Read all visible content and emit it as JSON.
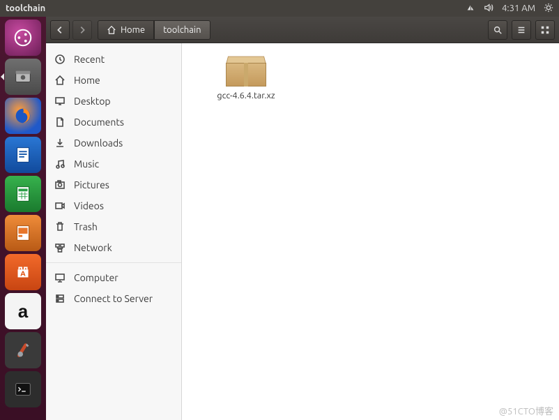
{
  "menubar": {
    "title": "toolchain",
    "time": "4:31 AM"
  },
  "launcher": {
    "items": [
      {
        "name": "dash",
        "label": "Dash"
      },
      {
        "name": "files",
        "label": "Files"
      },
      {
        "name": "firefox",
        "label": "Firefox"
      },
      {
        "name": "writer",
        "label": "LibreOffice Writer"
      },
      {
        "name": "calc",
        "label": "LibreOffice Calc"
      },
      {
        "name": "impress",
        "label": "LibreOffice Impress"
      },
      {
        "name": "software",
        "label": "Ubuntu Software"
      },
      {
        "name": "amazon",
        "label": "Amazon"
      },
      {
        "name": "settings",
        "label": "System Settings"
      },
      {
        "name": "terminal",
        "label": "Terminal"
      }
    ]
  },
  "toolbar": {
    "breadcrumb": {
      "home": "Home",
      "current": "toolchain"
    }
  },
  "sidebar": {
    "items": [
      {
        "icon": "clock",
        "label": "Recent"
      },
      {
        "icon": "home",
        "label": "Home"
      },
      {
        "icon": "desktop",
        "label": "Desktop"
      },
      {
        "icon": "doc",
        "label": "Documents"
      },
      {
        "icon": "download",
        "label": "Downloads"
      },
      {
        "icon": "music",
        "label": "Music"
      },
      {
        "icon": "picture",
        "label": "Pictures"
      },
      {
        "icon": "video",
        "label": "Videos"
      },
      {
        "icon": "trash",
        "label": "Trash"
      },
      {
        "icon": "network",
        "label": "Network"
      }
    ],
    "devices": [
      {
        "icon": "computer",
        "label": "Computer"
      },
      {
        "icon": "server",
        "label": "Connect to Server"
      }
    ]
  },
  "content": {
    "files": [
      {
        "name": "gcc-4.6.4.tar.xz",
        "type": "archive"
      }
    ]
  },
  "watermark": "@51CTO博客"
}
